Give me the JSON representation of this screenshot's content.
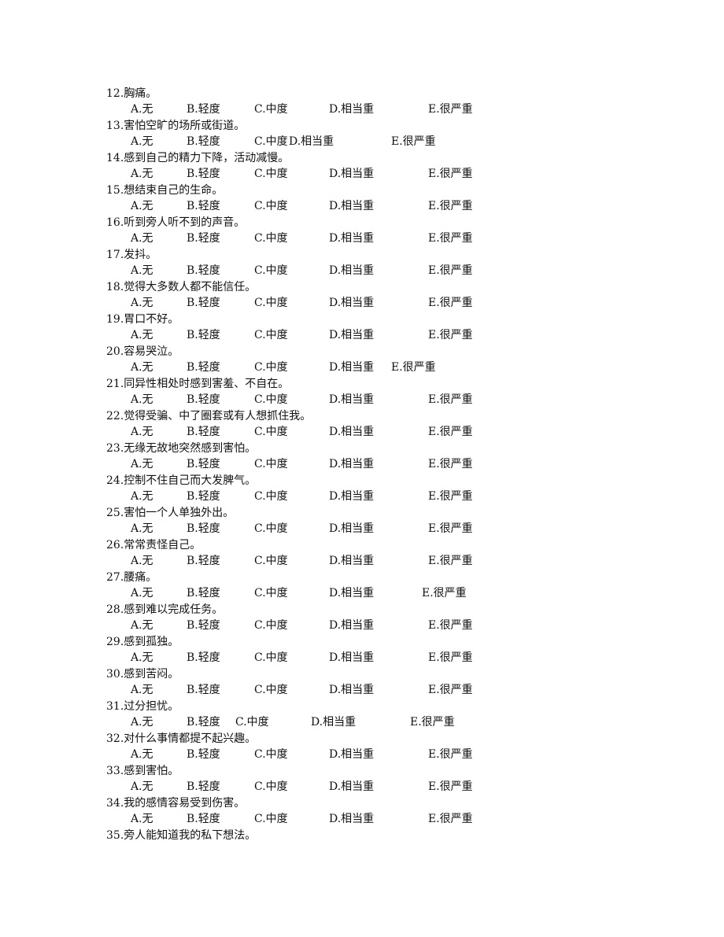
{
  "questions": [
    {
      "num": "12",
      "text": "12.胸痛。",
      "layout": "std"
    },
    {
      "num": "13",
      "text": "13.害怕空旷的场所或街道。",
      "layout": "v13"
    },
    {
      "num": "14",
      "text": "14.感到自己的精力下降，活动减慢。",
      "layout": "std"
    },
    {
      "num": "15",
      "text": "15.想结束自己的生命。",
      "layout": "std"
    },
    {
      "num": "16",
      "text": "16.听到旁人听不到的声音。",
      "layout": "std"
    },
    {
      "num": "17",
      "text": "17.发抖。",
      "layout": "std"
    },
    {
      "num": "18",
      "text": "18.觉得大多数人都不能信任。",
      "layout": "std"
    },
    {
      "num": "19",
      "text": "19.胃口不好。",
      "layout": "std"
    },
    {
      "num": "20",
      "text": "20.容易哭泣。",
      "layout": "v20"
    },
    {
      "num": "21",
      "text": "21.同异性相处时感到害羞、不自在。",
      "layout": "std"
    },
    {
      "num": "22",
      "text": "22.觉得受骗、中了圈套或有人想抓住我。",
      "layout": "std"
    },
    {
      "num": "23",
      "text": "23.无缘无故地突然感到害怕。",
      "layout": "std"
    },
    {
      "num": "24",
      "text": "24.控制不住自己而大发脾气。",
      "layout": "std"
    },
    {
      "num": "25",
      "text": "25.害怕一个人单独外出。",
      "layout": "std"
    },
    {
      "num": "26",
      "text": "26.常常责怪自己。",
      "layout": "std"
    },
    {
      "num": "27",
      "text": "27.腰痛。",
      "layout": "v27"
    },
    {
      "num": "28",
      "text": "28.感到难以完成任务。",
      "layout": "std"
    },
    {
      "num": "29",
      "text": "29.感到孤独。",
      "layout": "std"
    },
    {
      "num": "30",
      "text": "30.感到苦闷。",
      "layout": "std"
    },
    {
      "num": "31",
      "text": "31.过分担忧。",
      "layout": "v31"
    },
    {
      "num": "32",
      "text": "32.对什么事情都提不起兴趣。",
      "layout": "std"
    },
    {
      "num": "33",
      "text": "33.感到害怕。",
      "layout": "std"
    },
    {
      "num": "34",
      "text": "34.我的感情容易受到伤害。",
      "layout": "std"
    },
    {
      "num": "35",
      "text": "35.旁人能知道我的私下想法。",
      "layout": "none"
    }
  ],
  "options": [
    "A.无",
    "B.轻度",
    "C.中度",
    "D.相当重",
    "E.很严重"
  ]
}
